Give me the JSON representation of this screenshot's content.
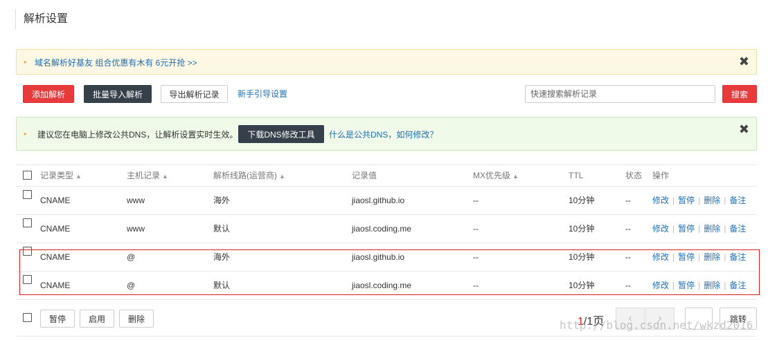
{
  "page": {
    "title": "解析设置"
  },
  "promo": {
    "text": "域名解析好基友 组合优惠有木有 6元开抢 >>"
  },
  "toolbar": {
    "add_label": "添加解析",
    "import_label": "批量导入解析",
    "export_label": "导出解析记录",
    "guide_label": "新手引导设置",
    "search_placeholder": "快速搜索解析记录",
    "search_label": "搜索"
  },
  "dns_tip": {
    "text": "建议您在电脑上修改公共DNS，让解析设置实时生效。",
    "button_label": "下载DNS修改工具",
    "link_label": "什么是公共DNS，如何修改？"
  },
  "close_glyph": "✖",
  "bullet_glyph": "•",
  "table": {
    "headers": {
      "type": "记录类型",
      "host": "主机记录",
      "line": "解析线路(运营商)",
      "value": "记录值",
      "mx": "MX优先级",
      "ttl": "TTL",
      "status": "状态",
      "ops": "操作"
    },
    "sort_glyph": "▲",
    "ops": {
      "edit": "修改",
      "pause": "暂停",
      "delete": "删除",
      "note": "备注"
    },
    "rows": [
      {
        "type": "CNAME",
        "host": "www",
        "line": "海外",
        "value": "jiaosl.github.io",
        "mx": "--",
        "ttl": "10分钟",
        "status": "--"
      },
      {
        "type": "CNAME",
        "host": "www",
        "line": "默认",
        "value": "jiaosl.coding.me",
        "mx": "--",
        "ttl": "10分钟",
        "status": "--"
      },
      {
        "type": "CNAME",
        "host": "@",
        "line": "海外",
        "value": "jiaosl.github.io",
        "mx": "--",
        "ttl": "10分钟",
        "status": "--"
      },
      {
        "type": "CNAME",
        "host": "@",
        "line": "默认",
        "value": "jiaosl.coding.me",
        "mx": "--",
        "ttl": "10分钟",
        "status": "--"
      }
    ]
  },
  "footer": {
    "pause_label": "暂停",
    "enable_label": "启用",
    "delete_label": "删除",
    "page_current": "1",
    "page_rest": "/1页",
    "prev_glyph": "‹",
    "next_glyph": "›",
    "jump_label": "跳转"
  },
  "watermark": "http://blog.csdn.net/wkzd2016"
}
